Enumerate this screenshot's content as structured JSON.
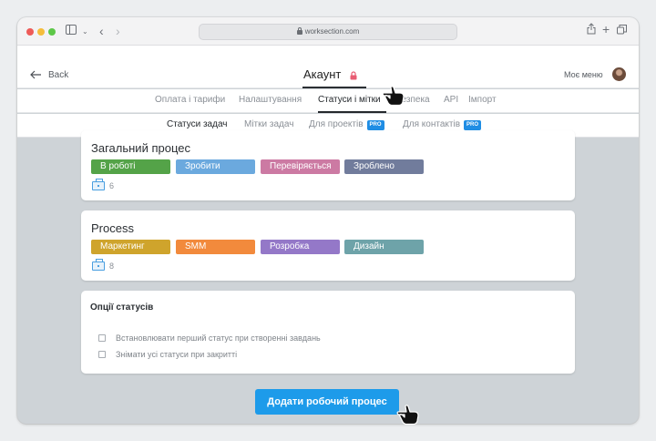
{
  "browser": {
    "url": "worksection.com"
  },
  "header": {
    "back_label": "Back",
    "title": "Акаунт",
    "my_menu_label": "Моє меню"
  },
  "main_tabs": [
    {
      "label": "Оплата і тарифи",
      "active": false
    },
    {
      "label": "Налаштування",
      "active": false
    },
    {
      "label": "Статуси і мітки",
      "active": true
    },
    {
      "label": "Безпека",
      "active": false
    },
    {
      "label": "API",
      "active": false
    },
    {
      "label": "Імпорт",
      "active": false
    }
  ],
  "sub_tabs": [
    {
      "label": "Статуси задач",
      "active": true,
      "pro": false
    },
    {
      "label": "Мітки задач",
      "active": false,
      "pro": false
    },
    {
      "label": "Для проектів",
      "active": false,
      "pro": true
    },
    {
      "label": "Для контактів",
      "active": false,
      "pro": true
    }
  ],
  "pro_badge": "PRO",
  "processes": [
    {
      "name": "Загальний процес",
      "statuses": [
        {
          "label": "В роботі",
          "color": "#54a348"
        },
        {
          "label": "Зробити",
          "color": "#6ba9de"
        },
        {
          "label": "Перевіряється",
          "color": "#cc7aa3"
        },
        {
          "label": "Зроблено",
          "color": "#717c9c"
        }
      ],
      "project_count": "6"
    },
    {
      "name": "Process",
      "statuses": [
        {
          "label": "Маркетинг",
          "color": "#cfa42c"
        },
        {
          "label": "SMM",
          "color": "#f28a3c"
        },
        {
          "label": "Розробка",
          "color": "#9478c8"
        },
        {
          "label": "Дизайн",
          "color": "#6ea3a9"
        }
      ],
      "project_count": "8"
    }
  ],
  "options": {
    "title": "Опції статусів",
    "items": [
      {
        "label": "Встановлювати перший статус при створенні завдань",
        "checked": false
      },
      {
        "label": "Знімати усі статуси при закритті",
        "checked": false
      }
    ]
  },
  "add_button_label": "Додати робочий процес",
  "colors": {
    "accent": "#1d9bea",
    "pro_badge": "#1f8de4",
    "lock": "#e95c73"
  }
}
